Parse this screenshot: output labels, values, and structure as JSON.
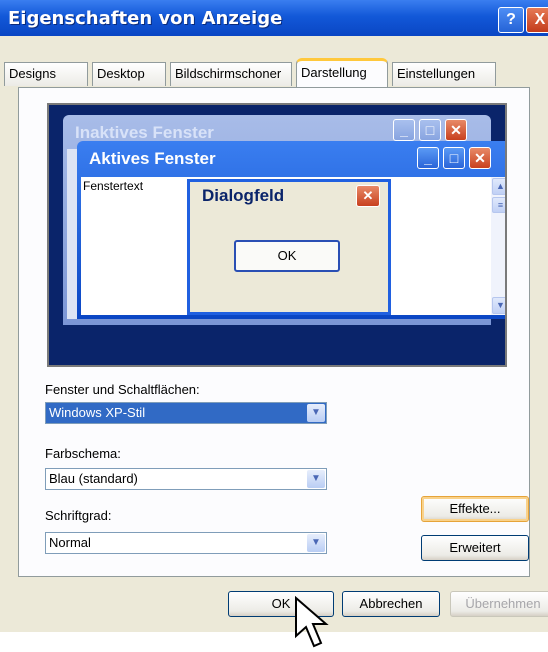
{
  "window": {
    "title": "Eigenschaften von Anzeige",
    "help": "?",
    "close": "X"
  },
  "tabs": [
    {
      "label": "Designs"
    },
    {
      "label": "Desktop"
    },
    {
      "label": "Bildschirmschoner"
    },
    {
      "label": "Darstellung",
      "active": true
    },
    {
      "label": "Einstellungen"
    }
  ],
  "preview": {
    "inactive_title": "Inaktives Fenster",
    "active_title": "Aktives Fenster",
    "window_text": "Fenstertext",
    "dialog_title": "Dialogfeld",
    "dialog_ok": "OK"
  },
  "settings": {
    "windows_buttons_label": "Fenster und Schaltflächen:",
    "windows_buttons_value": "Windows XP-Stil",
    "color_scheme_label": "Farbschema:",
    "color_scheme_value": "Blau (standard)",
    "font_size_label": "Schriftgrad:",
    "font_size_value": "Normal",
    "effects_button": "Effekte...",
    "advanced_button": "Erweitert"
  },
  "footer": {
    "ok": "OK",
    "cancel": "Abbrechen",
    "apply": "Übernehmen"
  },
  "colors": {
    "titlebar": "#0a46c4",
    "face": "#ece9d8",
    "preview_bg": "#0a246a",
    "selection": "#316ac5"
  }
}
